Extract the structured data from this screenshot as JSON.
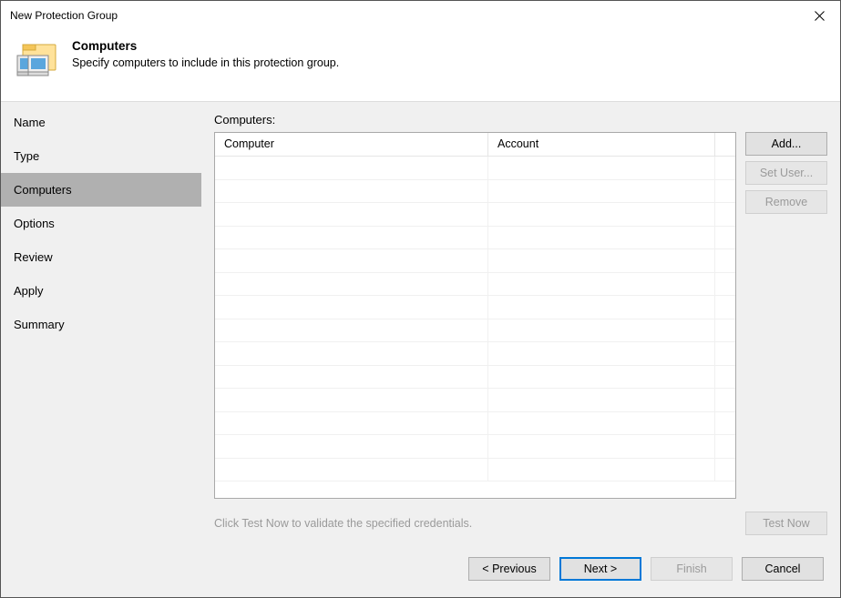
{
  "title": "New Protection Group",
  "header": {
    "heading": "Computers",
    "subheading": "Specify computers to include in this protection group."
  },
  "sidebar": {
    "items": [
      {
        "label": "Name",
        "active": false
      },
      {
        "label": "Type",
        "active": false
      },
      {
        "label": "Computers",
        "active": true
      },
      {
        "label": "Options",
        "active": false
      },
      {
        "label": "Review",
        "active": false
      },
      {
        "label": "Apply",
        "active": false
      },
      {
        "label": "Summary",
        "active": false
      }
    ]
  },
  "main": {
    "section_label": "Computers:",
    "columns": {
      "col1": "Computer",
      "col2": "Account"
    },
    "hint": "Click Test Now to validate the specified credentials."
  },
  "buttons": {
    "add": "Add...",
    "set_user": "Set User...",
    "remove": "Remove",
    "test_now": "Test Now",
    "previous": "< Previous",
    "next": "Next >",
    "finish": "Finish",
    "cancel": "Cancel"
  }
}
